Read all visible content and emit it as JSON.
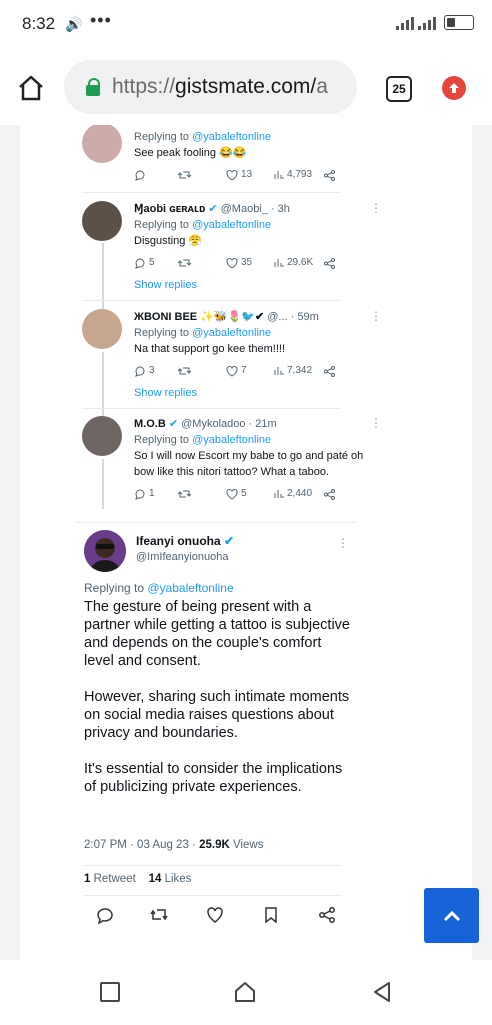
{
  "status": {
    "time": "8:32",
    "dots": "•••"
  },
  "browser": {
    "url_prefix": "https://",
    "url_domain": "gistsmate.com/",
    "url_tail": "a",
    "tabs_count": "25"
  },
  "replies": [
    {
      "name": "",
      "handle": "",
      "replying_label": "Replying to ",
      "replying_to": "@yabaleftonline",
      "text": "See peak fooling 😂😂",
      "comments": "",
      "likes": "13",
      "views": "4,793",
      "show_replies": ""
    },
    {
      "name": "Ɱaobi ɢᴇʀᴀʟᴅ",
      "handle": "@Maobi_ · 3h",
      "replying_label": "Replying to ",
      "replying_to": "@yabaleftonline",
      "text": "Disgusting 😤",
      "comments": "5",
      "likes": "35",
      "views": "29.6K",
      "show_replies": "Show replies"
    },
    {
      "name": "ЖBONI BEE ✨🐝🌷🐦✔",
      "handle": "@... · 59m",
      "replying_label": "Replying to ",
      "replying_to": "@yabaleftonline",
      "text": "Na that support go kee them!!!!",
      "comments": "3",
      "likes": "7",
      "views": "7,342",
      "show_replies": "Show replies"
    },
    {
      "name": "M.O.B",
      "handle": "@Mykoladoo · 21m",
      "replying_label": "Replying to ",
      "replying_to": "@yabaleftonline",
      "text": "So I will now Escort my babe to go and paté oh bow like this nitori tattoo? What a taboo.",
      "comments": "1",
      "likes": "5",
      "views": "2,440",
      "show_replies": ""
    }
  ],
  "main_tweet": {
    "name": "Ifeanyi onuoha",
    "handle": "@ImIfeanyionuoha",
    "replying_label": "Replying to ",
    "replying_to": "@yabaleftonline",
    "paragraphs": [
      "The gesture of being present with a partner while getting a tattoo is subjective and depends on the couple's comfort level and consent.",
      "However, sharing such intimate moments on social media raises questions about privacy and boundaries.",
      "It's essential to consider the implications of publicizing private experiences."
    ],
    "time": "2:07 PM · 03 Aug 23 · ",
    "views_count": "25.9K",
    "views_label": " Views",
    "retweets_count": "1",
    "retweets_label": " Retweet",
    "likes_count": "14",
    "likes_label": " Likes"
  },
  "colors": {
    "accent": "#1d9bf0",
    "verified": "#1d9bf0",
    "scroll_button": "#1663d8",
    "upload": "#e5473f"
  }
}
